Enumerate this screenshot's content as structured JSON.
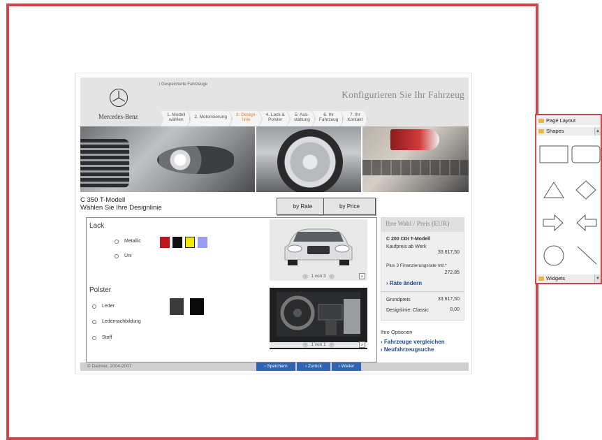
{
  "mockup": {
    "saved_vehicles": "⟩  Gespeicherte Fahrzeuge",
    "brand": "Mercedes-Benz",
    "title": "Konfigurieren Sie Ihr Fahrzeug",
    "steps": [
      {
        "line1": "1. Modell",
        "line2": "wählen"
      },
      {
        "line1": "2. Motorisierung",
        "line2": ""
      },
      {
        "line1": "3. Design-",
        "line2": "linie"
      },
      {
        "line1": "4. Lack &",
        "line2": "Polster"
      },
      {
        "line1": "5. Aus-",
        "line2": "stattung"
      },
      {
        "line1": "6. Ihr",
        "line2": "Fahrzeug"
      },
      {
        "line1": "7. Ihr",
        "line2": "Kontakt"
      }
    ],
    "model_line1": "C 350 T-Modell",
    "model_line2": "Wählen Sie Ihre Designlinie",
    "sort_rate": "by Rate",
    "sort_price": "by Price",
    "lack_title": "Lack",
    "lack_options": [
      "Metallic",
      "Uni"
    ],
    "lack_colors": [
      "#c0141e",
      "#111111",
      "#f5e800",
      "#9a9cf0"
    ],
    "polster_title": "Polster",
    "polster_options": [
      "Leder",
      "Ledernachbildung",
      "Stoff"
    ],
    "polster_colors": [
      "#3a3a3a",
      "#0a0a0a"
    ],
    "exterior_pager": "1 von 3",
    "interior_pager": "1 von 1",
    "summary": {
      "head": "Ihre Wahl / Preis (EUR)",
      "model": "C 200 CDI T-Modell",
      "kaufpreis_label": "Kaufpreis ab Werk",
      "kaufpreis_value": "33.617,50",
      "rate_label": "Plus 3 Finanzierungsrate mtl.*",
      "rate_value": "272,85",
      "rate_link": "›  Rate ändern",
      "grundpreis_label": "Grundpreis",
      "grundpreis_value": "33.617,50",
      "designlinie_label": "Designlinie: Classic",
      "designlinie_value": "0,00"
    },
    "options_title": "Ihre Optionen",
    "options_links": [
      "›  Fahrzeuge vergleichen",
      "›  Neufahrzeugsuche"
    ],
    "copyright": "© Daimler, 2004-2007",
    "footer_buttons": [
      "›  Speichern",
      "‹  Zurück",
      "›  Weiter"
    ],
    "accent_orange": "#e07b2b",
    "link_blue": "#1f4a8a",
    "button_blue": "#2f63b4"
  },
  "palette": {
    "page_layout": "Page Layout",
    "shapes": "Shapes",
    "widgets": "Widgets",
    "shape_items": [
      "rectangle-icon",
      "rounded-rectangle-icon",
      "triangle-icon",
      "diamond-icon",
      "arrow-right-icon",
      "arrow-left-icon",
      "circle-icon",
      "line-icon"
    ]
  },
  "frame_color": "#c9484b"
}
